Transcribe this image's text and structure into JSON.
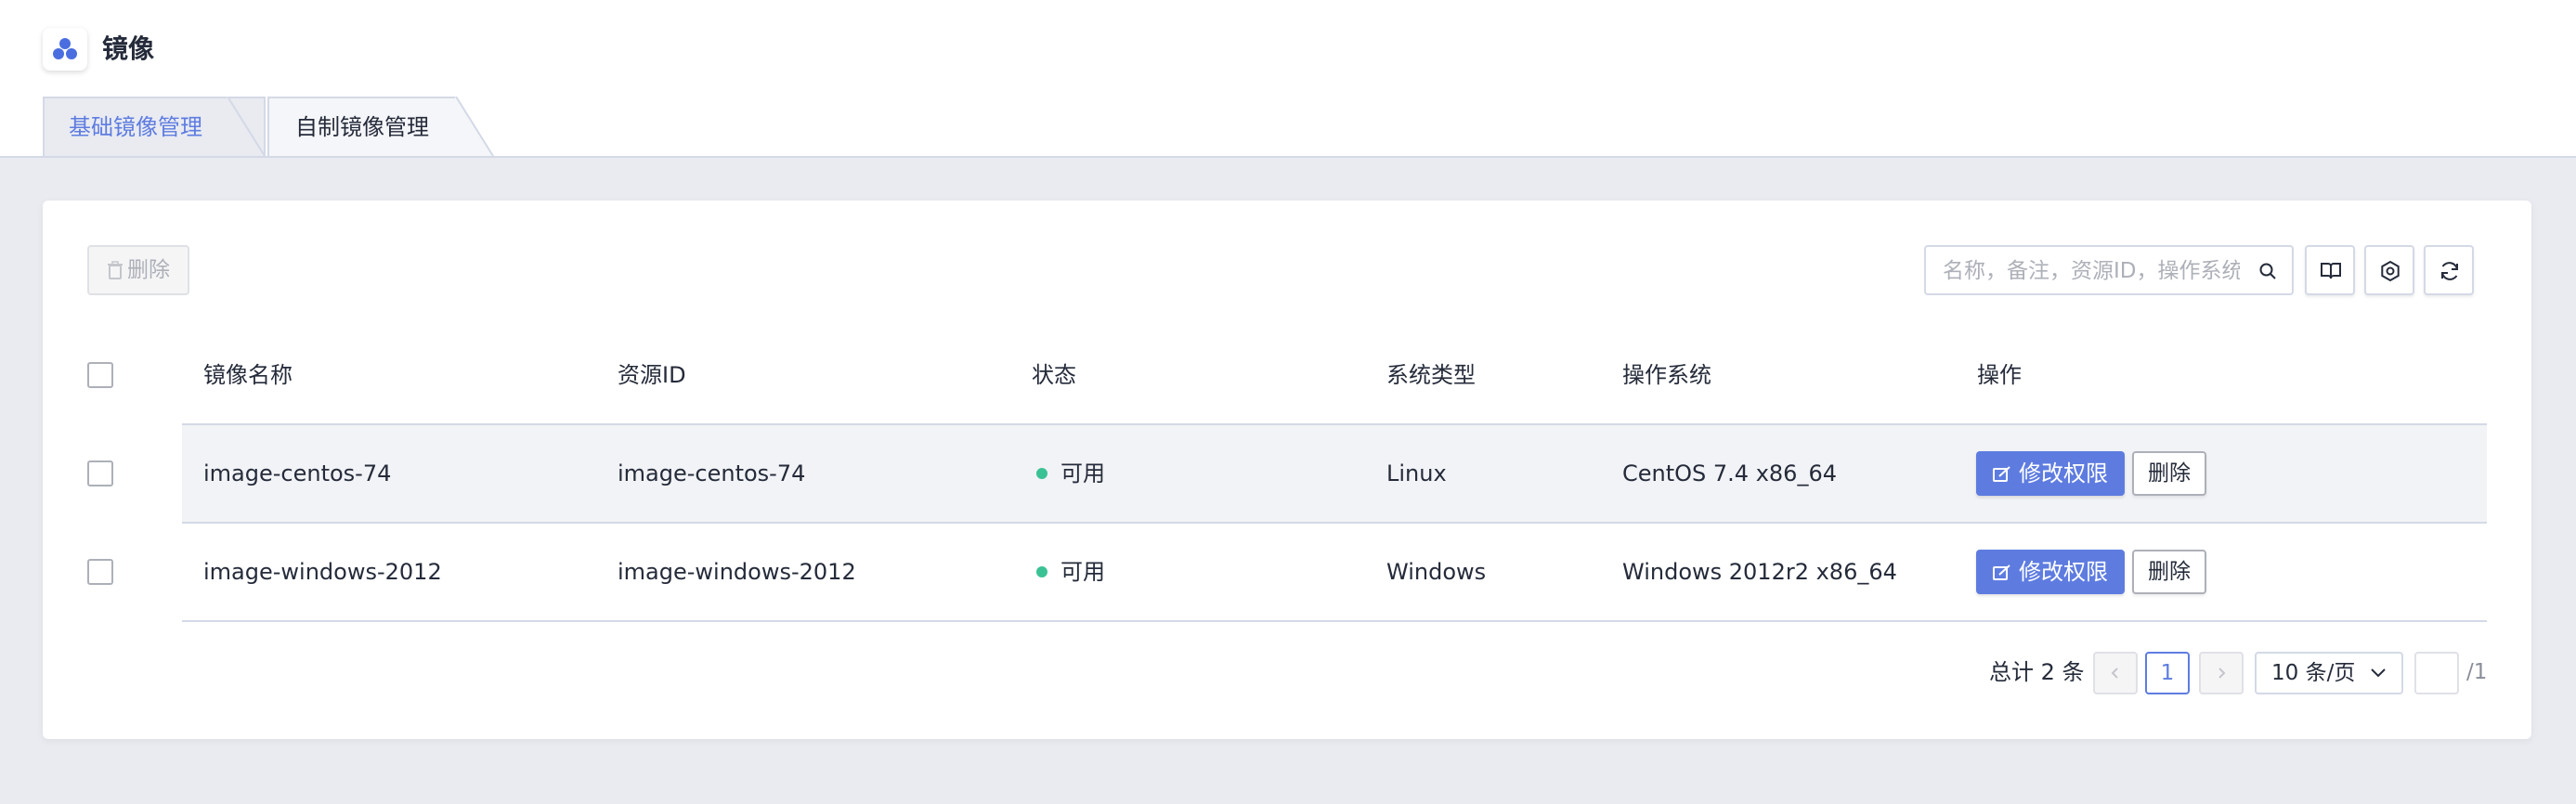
{
  "header": {
    "title": "镜像",
    "logo_icon": "cluster-dots-icon"
  },
  "tabs": [
    {
      "label": "基础镜像管理",
      "active": true
    },
    {
      "label": "自制镜像管理",
      "active": false
    }
  ],
  "toolbar": {
    "delete_label": "删除",
    "search_placeholder": "名称，备注，资源ID，操作系统",
    "icons": [
      "book-icon",
      "settings-icon",
      "refresh-icon"
    ]
  },
  "table": {
    "columns": [
      "镜像名称",
      "资源ID",
      "状态",
      "系统类型",
      "操作系统",
      "操作"
    ],
    "rows": [
      {
        "name": "image-centos-74",
        "resource_id": "image-centos-74",
        "status": "可用",
        "os_type": "Linux",
        "os": "CentOS 7.4 x86_64",
        "action_primary": "修改权限",
        "action_delete": "删除"
      },
      {
        "name": "image-windows-2012",
        "resource_id": "image-windows-2012",
        "status": "可用",
        "os_type": "Windows",
        "os": "Windows 2012r2 x86_64",
        "action_primary": "修改权限",
        "action_delete": "删除"
      }
    ]
  },
  "pagination": {
    "total": "总计 2 条",
    "current_page": "1",
    "page_size": "10 条/页",
    "total_pages": "/1"
  },
  "colors": {
    "primary": "#5e7ce0",
    "status_available": "#3ac295",
    "background": "#e9ebf1"
  }
}
